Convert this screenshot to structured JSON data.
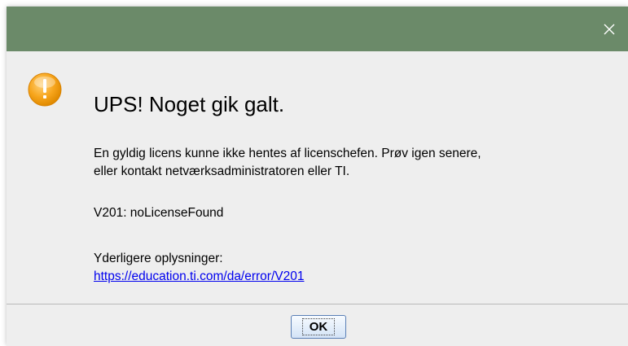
{
  "dialog": {
    "heading": "UPS! Noget gik galt.",
    "message_line1": "En gyldig licens kunne ikke hentes af licenschefen. Prøv igen senere,",
    "message_line2": "eller kontakt netværksadministratoren eller TI.",
    "error_code": "V201: noLicenseFound",
    "more_info_label": "Yderligere oplysninger:",
    "more_info_link": "https://education.ti.com/da/error/V201",
    "ok_label": "OK",
    "close_glyph": "✕",
    "icon": "warning-icon",
    "colors": {
      "titlebar": "#6b8a69",
      "icon": "#f5a623",
      "link": "#0000ee"
    }
  }
}
